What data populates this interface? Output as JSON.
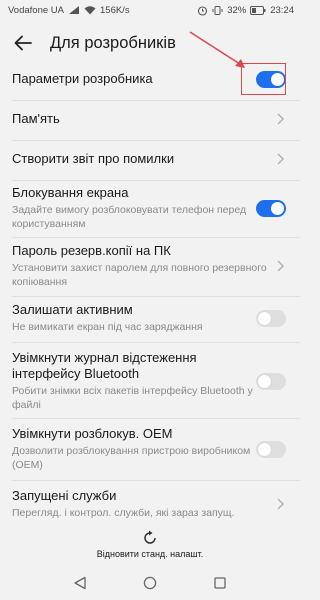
{
  "status_bar": {
    "carrier": "Vodafone UA",
    "speed": "156K/s",
    "battery": "32%",
    "time": "23:24"
  },
  "header": {
    "title": "Для розробників"
  },
  "settings": [
    {
      "label": "Параметри розробника",
      "desc": "",
      "control": "toggle",
      "state": "on"
    },
    {
      "label": "Пам'ять",
      "desc": "",
      "control": "chevron"
    },
    {
      "label": "Створити звіт про помилки",
      "desc": "",
      "control": "chevron"
    },
    {
      "label": "Блокування екрана",
      "desc": "Задайте вимогу розблоковувати телефон перед користуванням",
      "control": "toggle",
      "state": "on"
    },
    {
      "label": "Пароль резерв.копії на ПК",
      "desc": "Установити захист паролем для повного резервного копіювання",
      "control": "chevron"
    },
    {
      "label": "Залишати активним",
      "desc": "Не вимикати екран під час заряджання",
      "control": "toggle",
      "state": "off"
    },
    {
      "label": "Увімкнути журнал відстеження інтерфейсу Bluetooth",
      "desc": "Робити знімки всіх пакетів інтерфейсу Bluetooth у файлі",
      "control": "toggle",
      "state": "off"
    },
    {
      "label": "Увімкнути розблокув. OEM",
      "desc": "Дозволити розблокування пристрою виробником (OEM)",
      "control": "toggle",
      "state": "off"
    },
    {
      "label": "Запущені служби",
      "desc": "Перегляд. і контрол. служби, які зараз запущ.",
      "control": "chevron"
    }
  ],
  "bottom": {
    "reset_label": "Відновити станд. налашт."
  },
  "colors": {
    "accent": "#1e6ff0",
    "highlight": "#e0474c"
  },
  "icons": {
    "back": "arrow-left-icon",
    "chevron": "chevron-right-icon",
    "reset": "refresh-icon",
    "nav": [
      "back-triangle-icon",
      "home-circle-icon",
      "recents-square-icon"
    ]
  }
}
